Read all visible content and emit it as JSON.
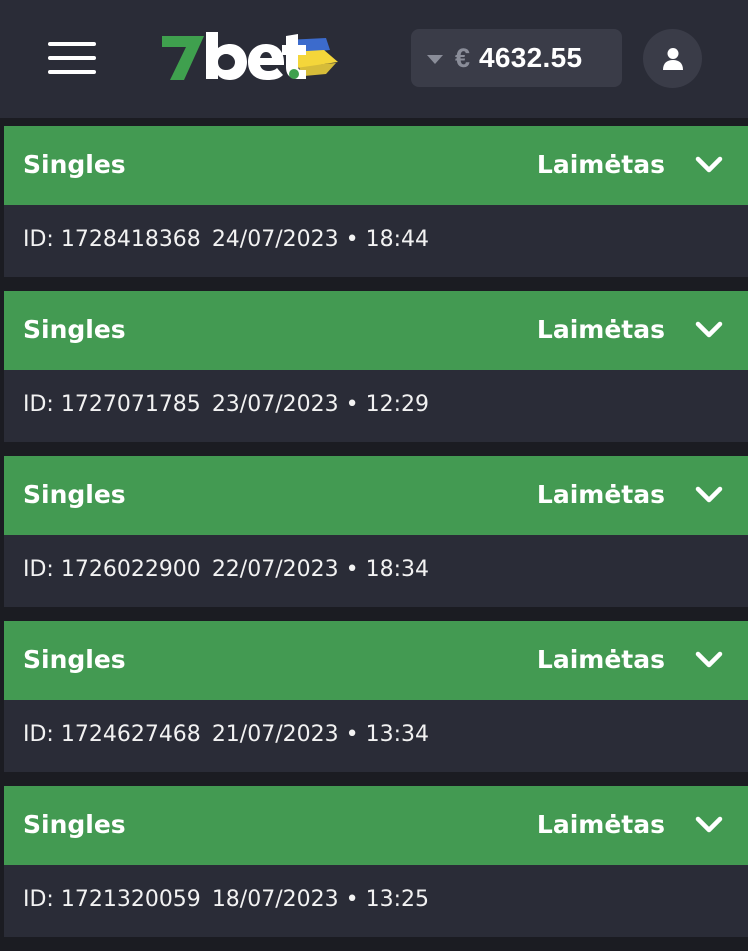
{
  "header": {
    "logo_text": "7bet",
    "balance": {
      "currency": "€",
      "amount": "4632.55"
    },
    "colors": {
      "logo_green": "#3fa04e",
      "flag_blue": "#3d6fd4",
      "flag_yellow": "#f4d63a"
    }
  },
  "bets": [
    {
      "type": "Singles",
      "status": "Laimėtas",
      "id": "ID: 1728418368",
      "datetime": "24/07/2023 • 18:44"
    },
    {
      "type": "Singles",
      "status": "Laimėtas",
      "id": "ID: 1727071785",
      "datetime": "23/07/2023 • 12:29"
    },
    {
      "type": "Singles",
      "status": "Laimėtas",
      "id": "ID: 1726022900",
      "datetime": "22/07/2023 • 18:34"
    },
    {
      "type": "Singles",
      "status": "Laimėtas",
      "id": "ID: 1724627468",
      "datetime": "21/07/2023 • 13:34"
    },
    {
      "type": "Singles",
      "status": "Laimėtas",
      "id": "ID: 1721320059",
      "datetime": "18/07/2023 • 13:25"
    }
  ],
  "colors": {
    "status_won": "#439a52",
    "card_bg": "#2a2c37",
    "page_bg": "#1b1c22"
  }
}
